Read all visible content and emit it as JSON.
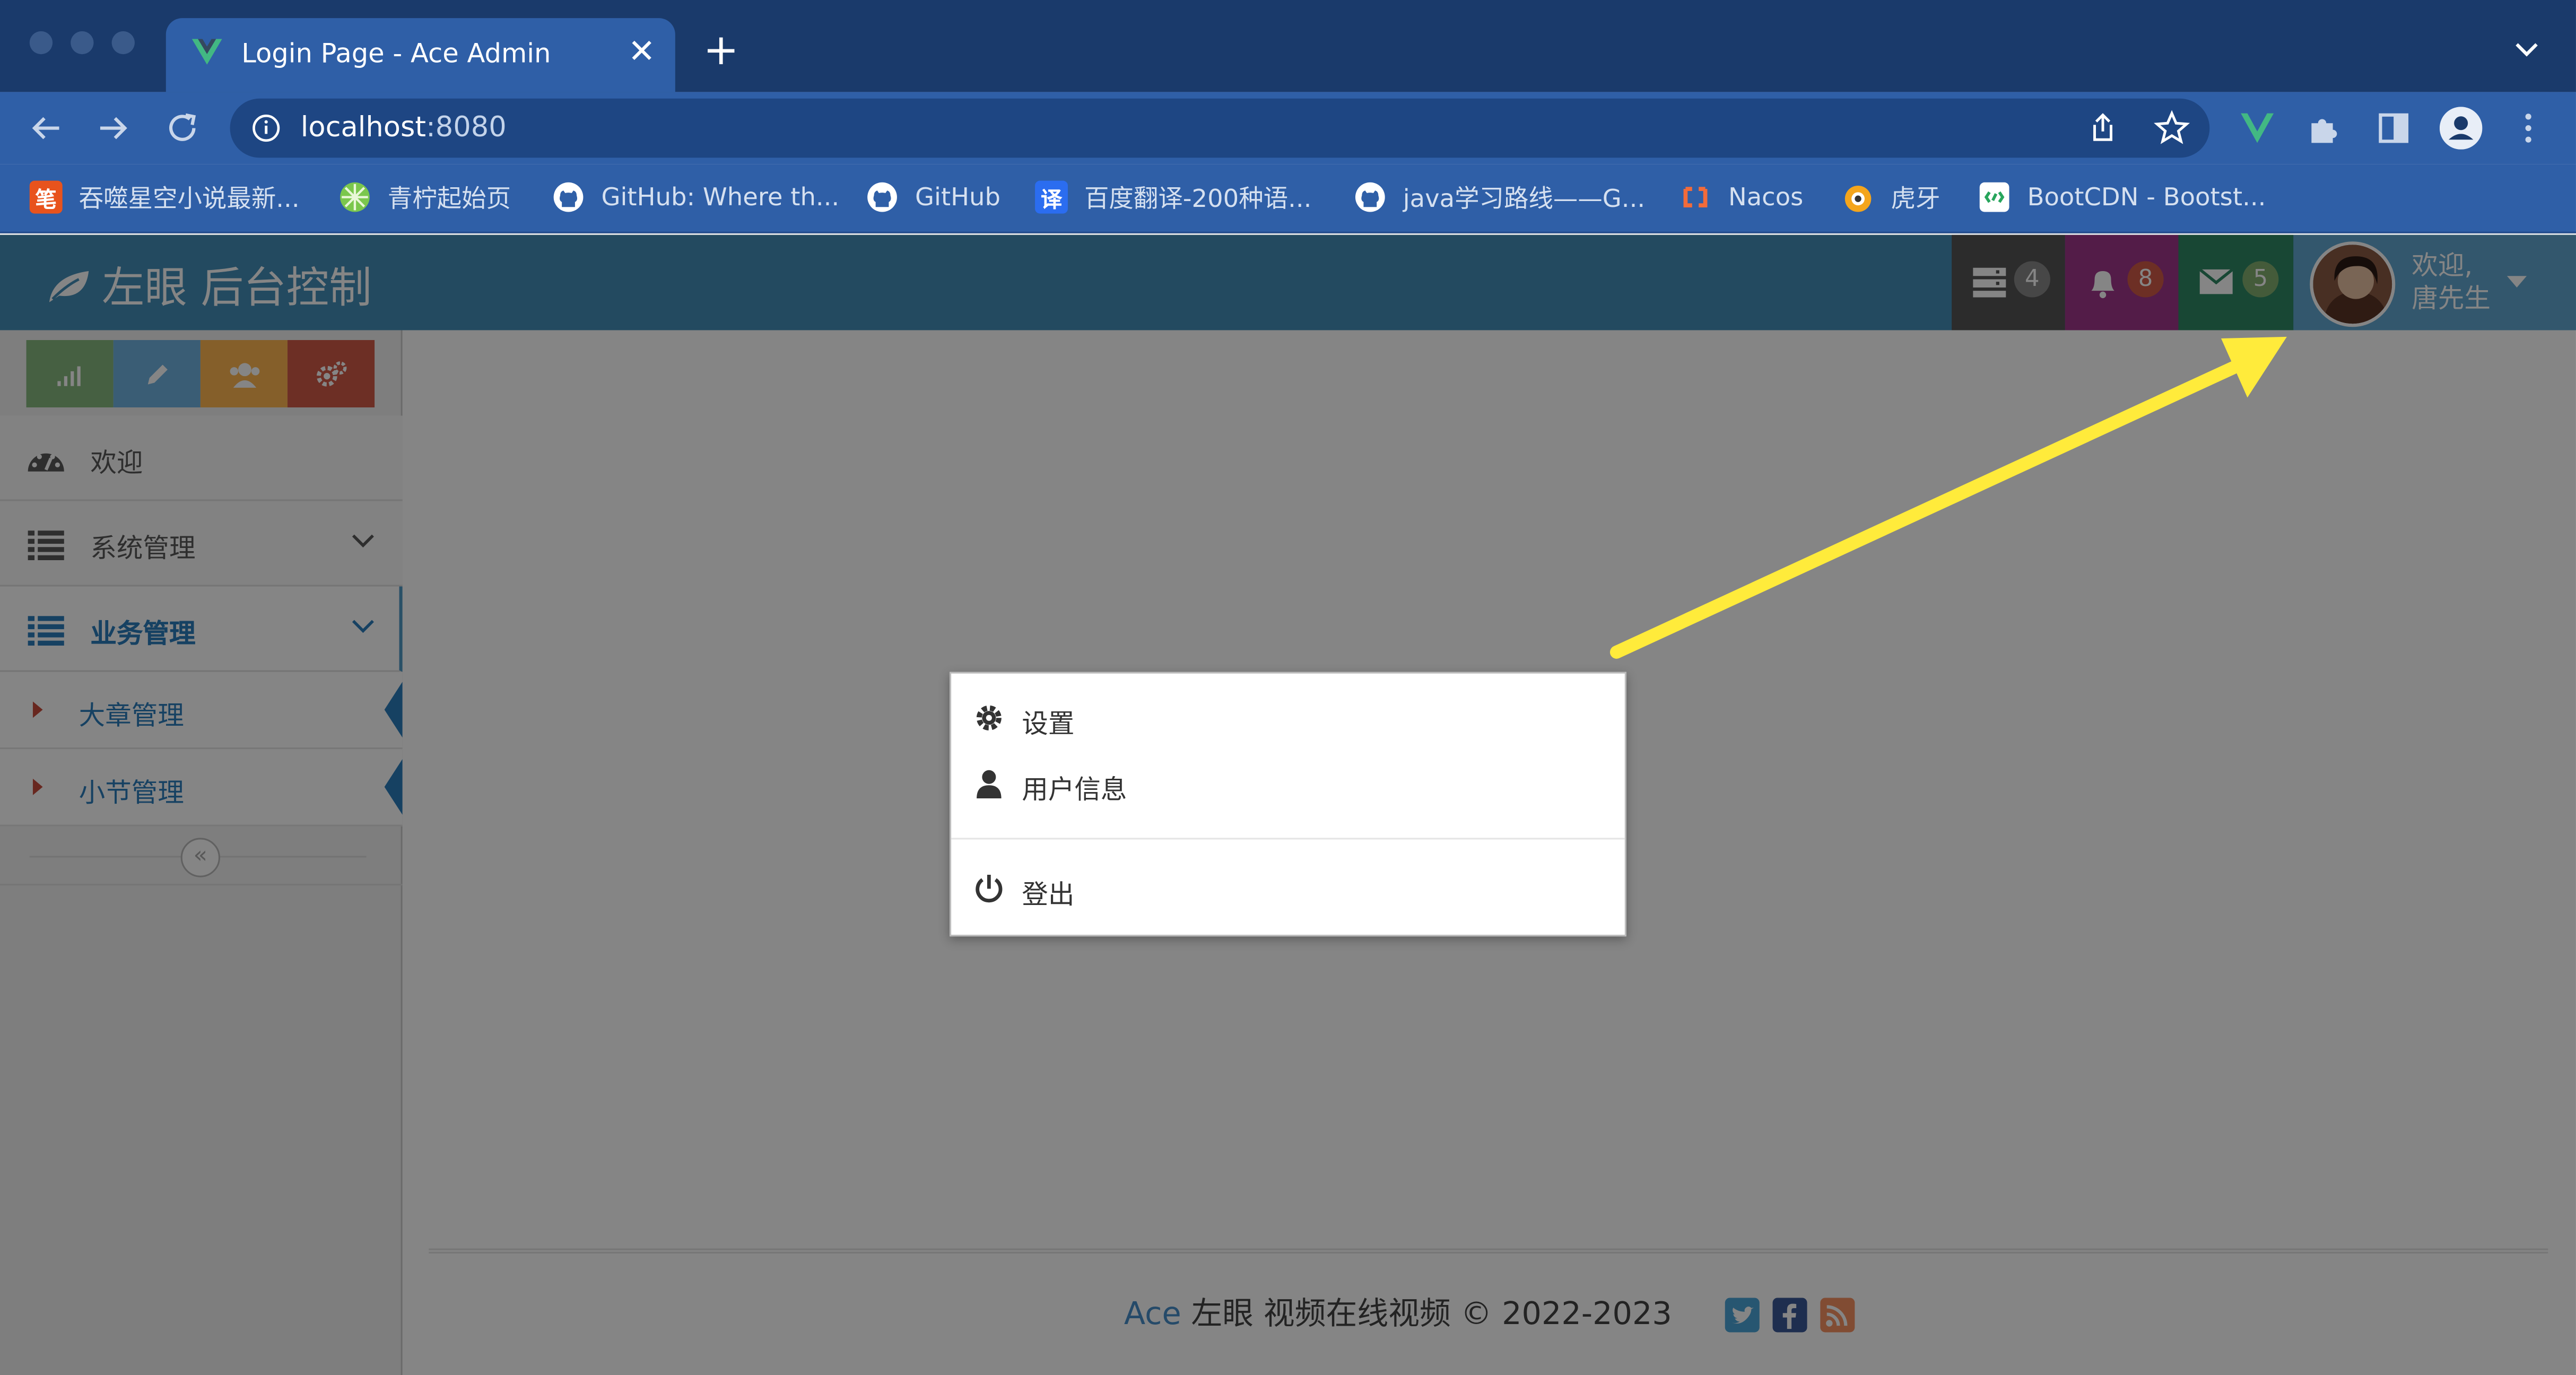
{
  "browser": {
    "tab_title": "Login Page - Ace Admin",
    "url_host": "localhost",
    "url_port": ":8080"
  },
  "bookmarks": [
    {
      "label": "吞噬星空小说最新...",
      "icon": "笔",
      "icon_color": "#e8531d"
    },
    {
      "label": "青柠起始页",
      "icon": "lime-icon",
      "icon_color": "#7bc74d"
    },
    {
      "label": "GitHub: Where th...",
      "icon": "github-icon",
      "icon_color": "#ffffff"
    },
    {
      "label": "GitHub",
      "icon": "github-icon",
      "icon_color": "#ffffff"
    },
    {
      "label": "百度翻译-200种语...",
      "icon": "译",
      "icon_color": "#2b6df0"
    },
    {
      "label": "java学习路线——G...",
      "icon": "github-icon",
      "icon_color": "#ffffff"
    },
    {
      "label": "Nacos",
      "icon": "nacos-icon",
      "icon_color": "#f26b3a"
    },
    {
      "label": "虎牙",
      "icon": "huya-icon",
      "icon_color": "#f4a51c"
    },
    {
      "label": "BootCDN - Bootst...",
      "icon": "bootcdn-icon",
      "icon_color": "#27a55c"
    }
  ],
  "app": {
    "brand": "左眼 后台控制",
    "tasks_count": "4",
    "notifications_count": "8",
    "messages_count": "5",
    "user_greeting": "欢迎,",
    "user_name": "唐先生"
  },
  "sidebar": {
    "items": [
      {
        "label": "欢迎"
      },
      {
        "label": "系统管理"
      },
      {
        "label": "业务管理"
      }
    ],
    "submenu": [
      {
        "label": "大章管理"
      },
      {
        "label": "小节管理"
      }
    ]
  },
  "dropdown": {
    "settings": "设置",
    "profile": "用户信息",
    "logout": "登出"
  },
  "footer": {
    "brand": "Ace",
    "text": " 左眼 视频在线视频 © 2022-2023"
  },
  "colors": {
    "navbar": "#438eb9",
    "tasks": "#555555",
    "notifications": "#a0368b",
    "messages": "#2e8965",
    "user": "#62a8d1",
    "annotation_arrow": "#ffeb3b"
  }
}
